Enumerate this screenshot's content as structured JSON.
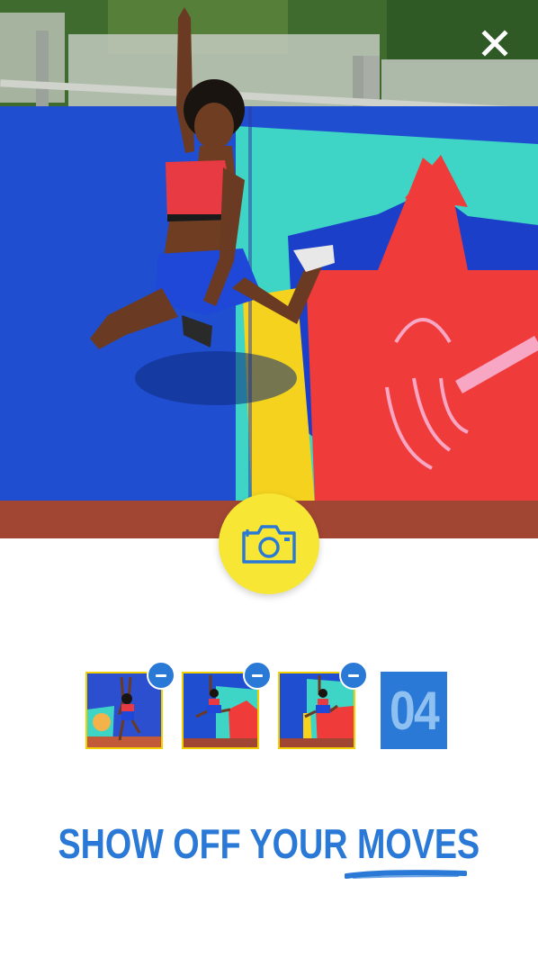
{
  "close_button": {
    "icon": "close-icon"
  },
  "camera_button": {
    "icon": "camera-icon",
    "color": "#f7e634"
  },
  "thumbnails": [
    {
      "name": "photo-1",
      "remove_icon": "minus-icon"
    },
    {
      "name": "photo-2",
      "remove_icon": "minus-icon"
    },
    {
      "name": "photo-3",
      "remove_icon": "minus-icon"
    }
  ],
  "remaining_count": "04",
  "headline": {
    "prefix": "SHOW OFF YOUR ",
    "emphasis": "MOVES"
  },
  "colors": {
    "accent_blue": "#2a79d6",
    "yellow": "#f7e634",
    "thumb_border": "#f2d000"
  }
}
